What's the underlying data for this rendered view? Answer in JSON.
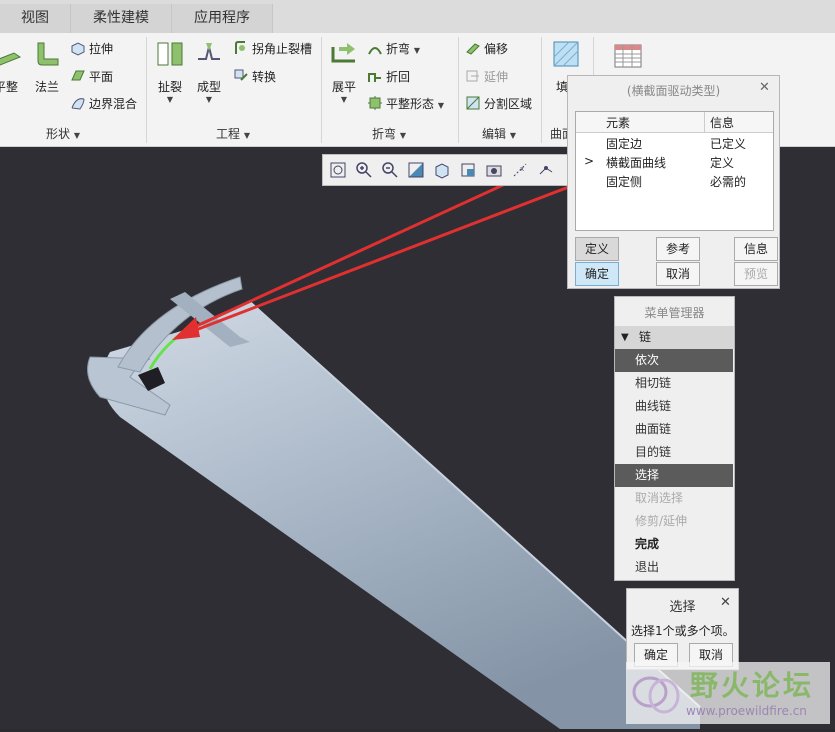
{
  "tabs": [
    "视图",
    "柔性建模",
    "应用程序"
  ],
  "ribbon": {
    "shape": {
      "cut1": "平整",
      "flange": "法兰",
      "extrude": "拉伸",
      "planar": "平面",
      "boundary_blend": "边界混合",
      "label": "形状"
    },
    "engineering": {
      "rip": "扯裂",
      "form": "成型",
      "corner_relief": "拐角止裂槽",
      "convert": "转换",
      "label": "工程"
    },
    "bend": {
      "unbend": "展平",
      "bend": "折弯",
      "bend_back": "折回",
      "flat_state": "平整形态",
      "label": "折弯"
    },
    "edit": {
      "offset": "偏移",
      "extend": "延伸",
      "split_area": "分割区域",
      "label": "编辑"
    },
    "surface": {
      "fill": "填",
      "label": "曲面"
    }
  },
  "dialog": {
    "title": "(横截面驱动类型)",
    "col_element": "元素",
    "col_info": "信息",
    "rows": [
      {
        "marker": "",
        "element": "固定边",
        "info": "已定义"
      },
      {
        "marker": ">",
        "element": "横截面曲线",
        "info": "定义"
      },
      {
        "marker": "",
        "element": "固定侧",
        "info": "必需的"
      }
    ],
    "define": "定义",
    "reference": "参考",
    "info": "信息",
    "ok": "确定",
    "cancel": "取消",
    "preview": "预览"
  },
  "menu_manager": {
    "title": "菜单管理器",
    "section": "链",
    "items": [
      "依次",
      "相切链",
      "曲线链",
      "曲面链",
      "目的链",
      "选择",
      "取消选择",
      "修剪/延伸",
      "完成",
      "退出"
    ]
  },
  "select_dialog": {
    "title": "选择",
    "message": "选择1个或多个项。",
    "ok": "确定",
    "cancel": "取消"
  },
  "watermark": {
    "name": "野火论坛",
    "url": "www.proewildfire.cn"
  }
}
